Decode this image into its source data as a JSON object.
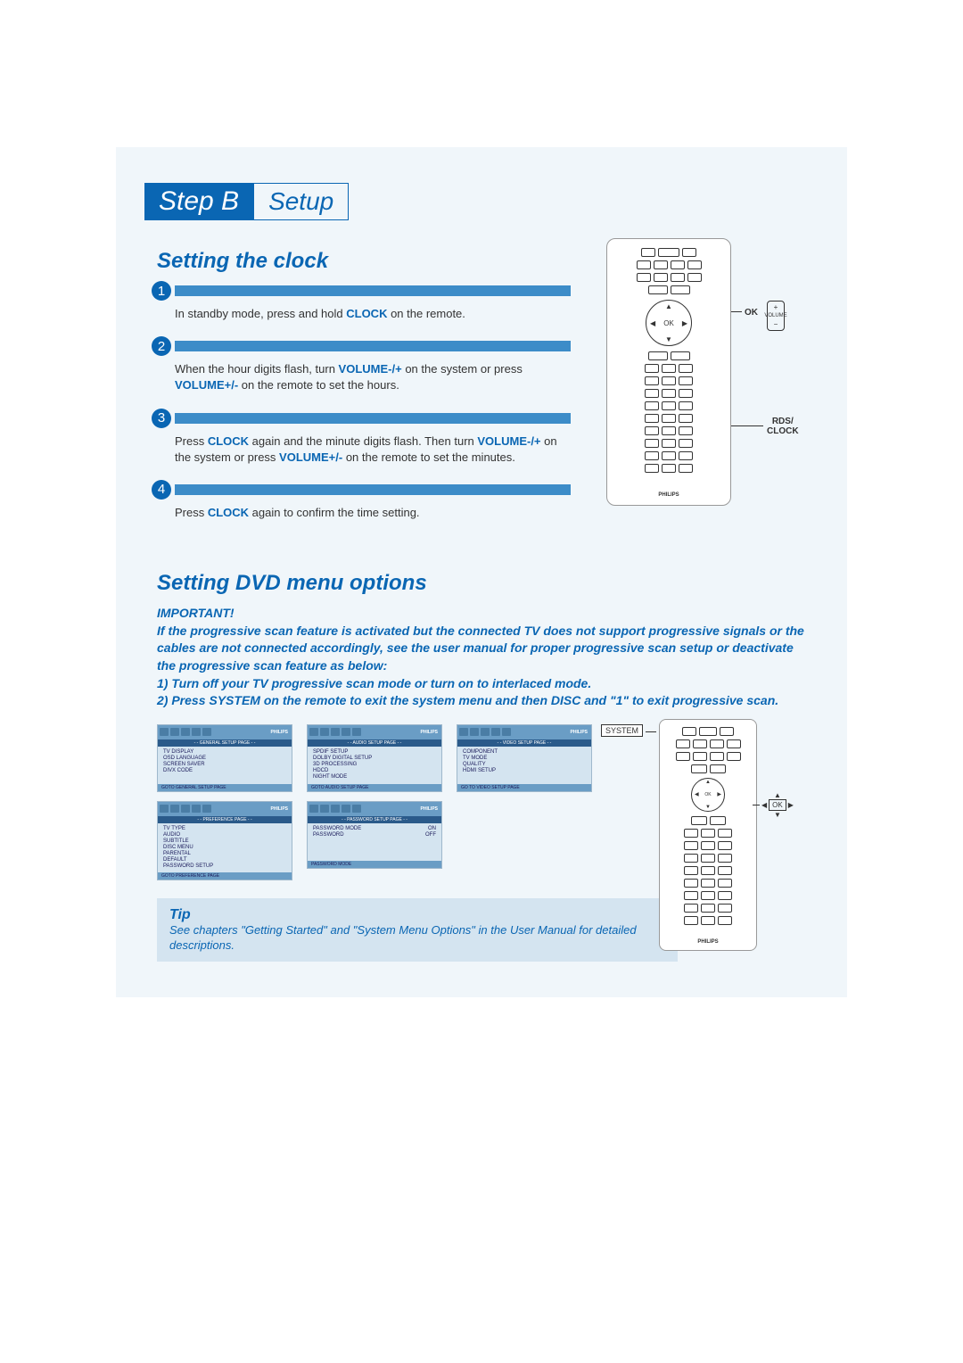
{
  "header": {
    "step_label": "Step B",
    "setup_label": "Setup"
  },
  "section1": {
    "title": "Setting the clock",
    "steps": [
      {
        "n": "1",
        "pre": "In standby mode, press and hold ",
        "hl1": "CLOCK",
        "post": " on the remote."
      },
      {
        "n": "2",
        "pre": "When the hour digits flash, turn ",
        "hl1": "VOLUME-/+",
        "mid": " on the system or press ",
        "hl2": "VOLUME+/-",
        "post": " on the remote to set the hours."
      },
      {
        "n": "3",
        "pre": "Press ",
        "hl1": "CLOCK",
        "mid": " again and the minute digits flash. Then turn ",
        "hl2": "VOLUME-/+",
        "mid2": " on the system or press ",
        "hl3": "VOLUME+/-",
        "post": " on the remote to set the minutes."
      },
      {
        "n": "4",
        "pre": "Press ",
        "hl1": "CLOCK",
        "post": " again to confirm the time setting."
      }
    ],
    "remote": {
      "ok": "OK",
      "brand": "PHILIPS",
      "callout_ok": "OK",
      "callout_vol": "VOLUME",
      "vol_plus": "+",
      "vol_minus": "−",
      "callout_clock_line1": "RDS/",
      "callout_clock_line2": "CLOCK"
    }
  },
  "section2": {
    "title": "Setting DVD menu options",
    "important_title": "IMPORTANT!",
    "important_body": "If the progressive scan feature is activated but the connected TV does not support progressive signals or the cables are not connected accordingly, see the user manual for proper progressive scan setup or deactivate the progressive scan feature as below:",
    "important_line1": "1) Turn off your TV progressive scan mode or turn on to interlaced mode.",
    "important_line2": "2) Press SYSTEM on the remote to exit the system menu and then DISC and \"1\" to exit progressive scan.",
    "tip_title": "Tip",
    "tip_text": "See chapters \"Getting Started\" and \"System Menu Options\" in the User Manual for detailed descriptions.",
    "callout_system": "SYSTEM",
    "callout_ok": "OK",
    "remote_brand": "PHILIPS"
  },
  "menu_panels": {
    "brand": "PHILIPS",
    "p1": {
      "header": "- - GENERAL SETUP PAGE - -",
      "items": [
        "TV DISPLAY",
        "OSD LANGUAGE",
        "SCREEN SAVER",
        "DIVX CODE"
      ],
      "footer": "GOTO GENERAL SETUP PAGE"
    },
    "p2": {
      "header": "- - AUDIO SETUP PAGE - -",
      "items": [
        "SPDIF SETUP",
        "DOLBY DIGITAL SETUP",
        "3D PROCESSING",
        "HDCD",
        "NIGHT MODE"
      ],
      "footer": "GOTO AUDIO SETUP PAGE"
    },
    "p3": {
      "header": "- - VIDEO SETUP PAGE - -",
      "items": [
        "COMPONENT",
        "TV MODE",
        "QUALITY",
        "HDMI SETUP"
      ],
      "footer": "GO TO VIDEO SETUP PAGE"
    },
    "p4": {
      "header": "- - PREFERENCE PAGE - -",
      "items": [
        "TV TYPE",
        "AUDIO",
        "SUBTITLE",
        "DISC MENU",
        "PARENTAL",
        "DEFAULT",
        "PASSWORD SETUP"
      ],
      "footer": "GOTO PREFERENCE PAGE"
    },
    "p5": {
      "header": "- - PASSWORD SETUP PAGE - -",
      "rows": [
        {
          "k": "PASSWORD MODE",
          "v": "ON"
        },
        {
          "k": "PASSWORD",
          "v": "OFF"
        }
      ],
      "footer": "PASSWORD MODE"
    }
  }
}
